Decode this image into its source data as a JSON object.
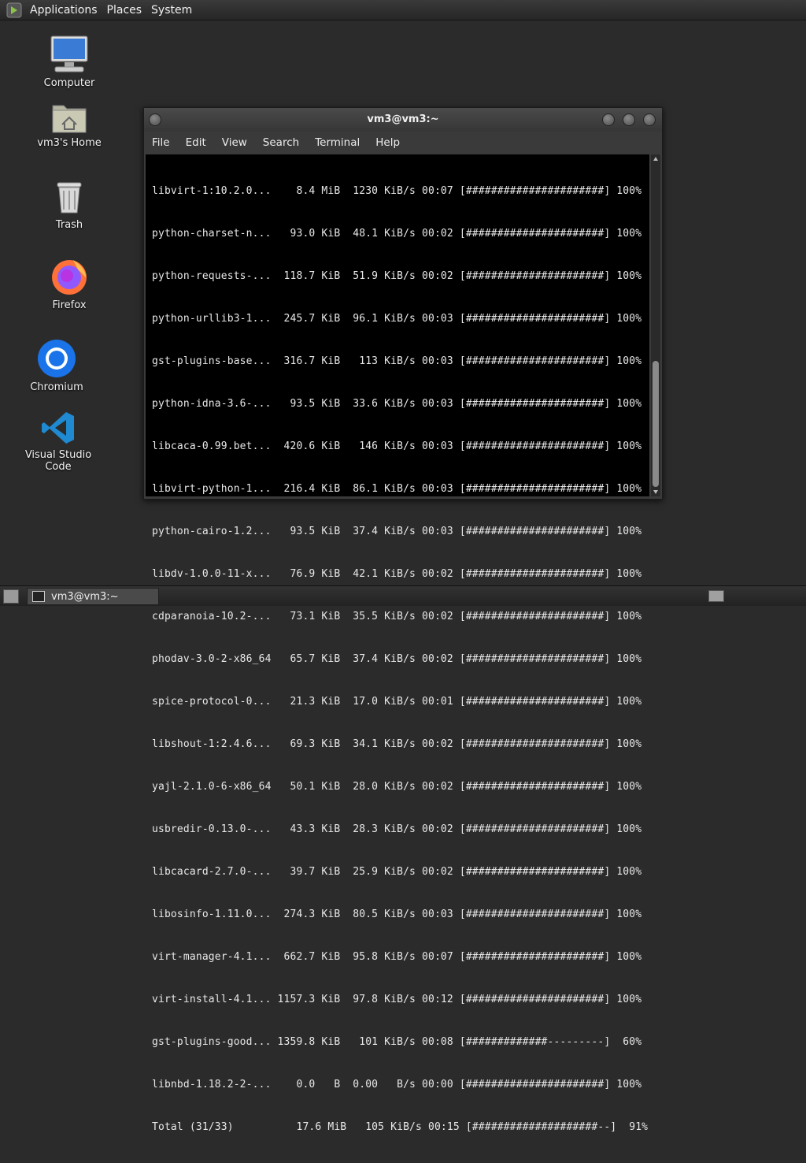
{
  "top_panel": {
    "menus": [
      "Applications",
      "Places",
      "System"
    ]
  },
  "desktop_icons": {
    "computer": "Computer",
    "home": "vm3's Home",
    "trash": "Trash",
    "firefox": "Firefox",
    "chromium": "Chromium",
    "vscode": "Visual Studio Code"
  },
  "terminal": {
    "title": "vm3@vm3:~",
    "menus": [
      "File",
      "Edit",
      "View",
      "Search",
      "Terminal",
      "Help"
    ],
    "lines": [
      "libvirt-1:10.2.0...    8.4 MiB  1230 KiB/s 00:07 [######################] 100%",
      "python-charset-n...   93.0 KiB  48.1 KiB/s 00:02 [######################] 100%",
      "python-requests-...  118.7 KiB  51.9 KiB/s 00:02 [######################] 100%",
      "python-urllib3-1...  245.7 KiB  96.1 KiB/s 00:03 [######################] 100%",
      "gst-plugins-base...  316.7 KiB   113 KiB/s 00:03 [######################] 100%",
      "python-idna-3.6-...   93.5 KiB  33.6 KiB/s 00:03 [######################] 100%",
      "libcaca-0.99.bet...  420.6 KiB   146 KiB/s 00:03 [######################] 100%",
      "libvirt-python-1...  216.4 KiB  86.1 KiB/s 00:03 [######################] 100%",
      "python-cairo-1.2...   93.5 KiB  37.4 KiB/s 00:03 [######################] 100%",
      "libdv-1.0.0-11-x...   76.9 KiB  42.1 KiB/s 00:02 [######################] 100%",
      "cdparanoia-10.2-...   73.1 KiB  35.5 KiB/s 00:02 [######################] 100%",
      "phodav-3.0-2-x86_64   65.7 KiB  37.4 KiB/s 00:02 [######################] 100%",
      "spice-protocol-0...   21.3 KiB  17.0 KiB/s 00:01 [######################] 100%",
      "libshout-1:2.4.6...   69.3 KiB  34.1 KiB/s 00:02 [######################] 100%",
      "yajl-2.1.0-6-x86_64   50.1 KiB  28.0 KiB/s 00:02 [######################] 100%",
      "usbredir-0.13.0-...   43.3 KiB  28.3 KiB/s 00:02 [######################] 100%",
      "libcacard-2.7.0-...   39.7 KiB  25.9 KiB/s 00:02 [######################] 100%",
      "libosinfo-1.11.0...  274.3 KiB  80.5 KiB/s 00:03 [######################] 100%",
      "virt-manager-4.1...  662.7 KiB  95.8 KiB/s 00:07 [######################] 100%",
      "virt-install-4.1... 1157.3 KiB  97.8 KiB/s 00:12 [######################] 100%",
      "gst-plugins-good... 1359.8 KiB   101 KiB/s 00:08 [#############---------]  60%",
      "libnbd-1.18.2-2-...    0.0   B  0.00   B/s 00:00 [######################] 100%",
      "Total (31/33)          17.6 MiB   105 KiB/s 00:15 [####################--]  91%"
    ]
  },
  "taskbar": {
    "window_label": "vm3@vm3:~"
  }
}
